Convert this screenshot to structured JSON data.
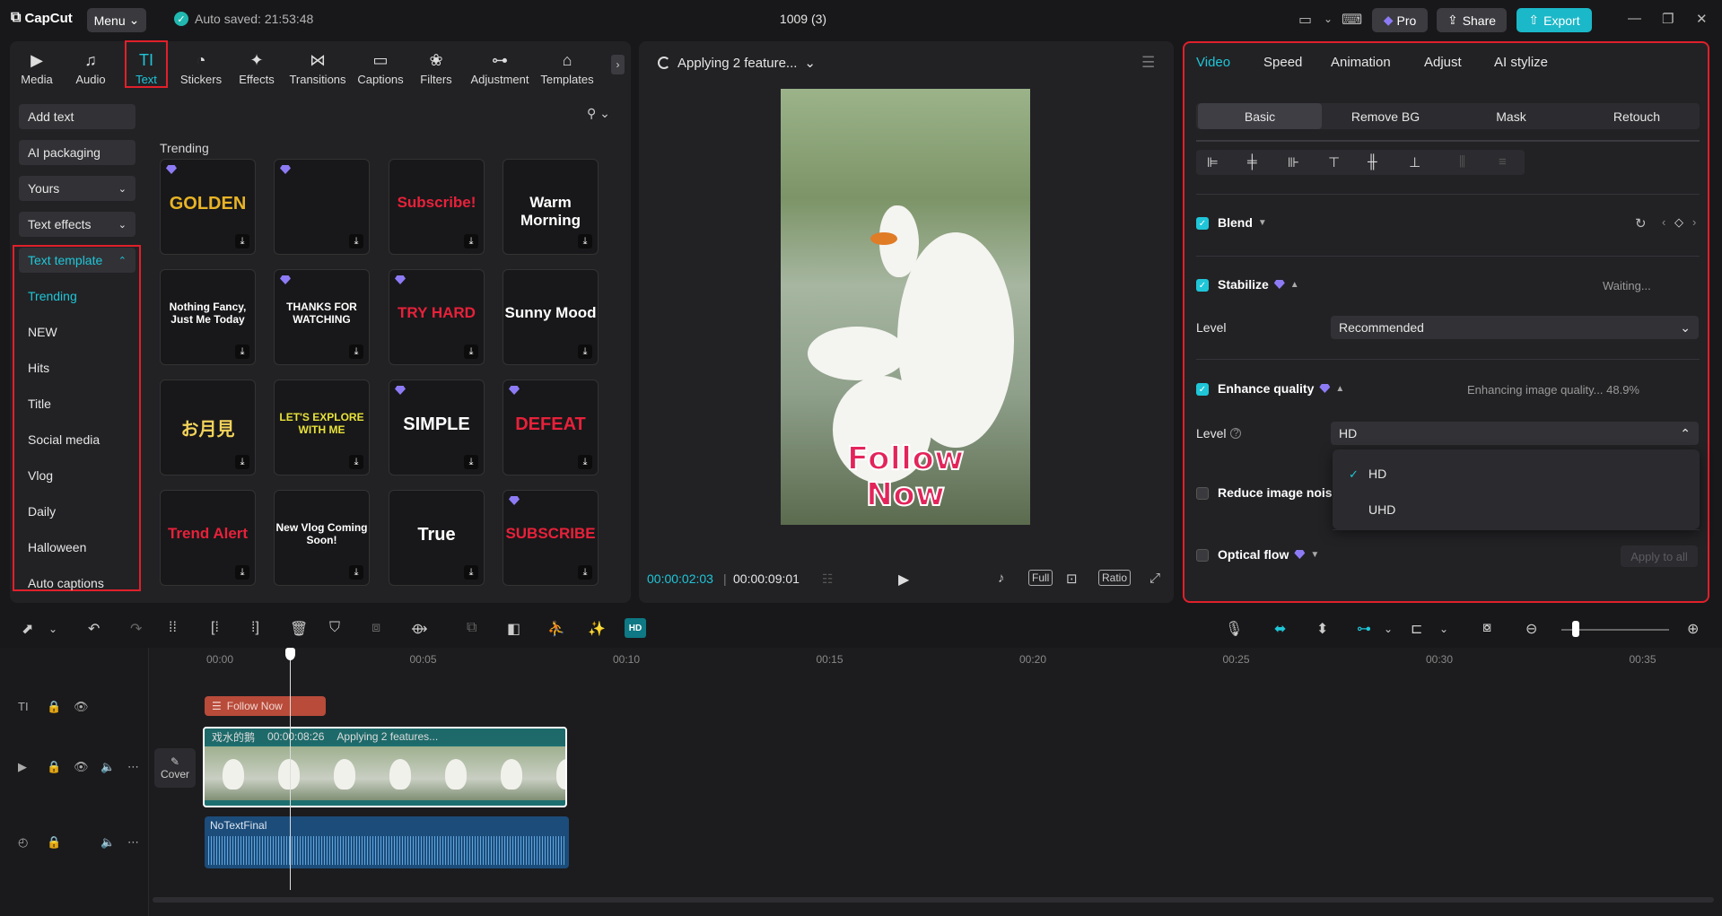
{
  "app": {
    "logo": "CapCut",
    "menu_label": "Menu",
    "autosave": "Auto saved: 21:53:48",
    "project_title": "1009 (3)",
    "pro_label": "Pro",
    "share_label": "Share",
    "export_label": "Export"
  },
  "left": {
    "tabs": [
      {
        "label": "Media",
        "icon": "▶"
      },
      {
        "label": "Audio",
        "icon": "♫"
      },
      {
        "label": "Text",
        "icon": "TI"
      },
      {
        "label": "Stickers",
        "icon": "◔"
      },
      {
        "label": "Effects",
        "icon": "✦"
      },
      {
        "label": "Transitions",
        "icon": "⋈"
      },
      {
        "label": "Captions",
        "icon": "▭"
      },
      {
        "label": "Filters",
        "icon": "❀"
      },
      {
        "label": "Adjustment",
        "icon": "⊶"
      },
      {
        "label": "Templates",
        "icon": "⌂"
      }
    ],
    "side_buttons": [
      "Add text",
      "AI packaging",
      "Yours",
      "Text effects",
      "Text template"
    ],
    "categories": [
      "Trending",
      "NEW",
      "Hits",
      "Title",
      "Social media",
      "Vlog",
      "Daily",
      "Halloween",
      "Auto captions"
    ],
    "section_title": "Trending",
    "cards": [
      {
        "text": "GOLDEN",
        "color": "#e8b326",
        "pro": true
      },
      {
        "text": "",
        "color": "#fff",
        "pro": true
      },
      {
        "text": "Subscribe!",
        "color": "#e8213a",
        "pro": false
      },
      {
        "text": "Warm Morning",
        "color": "#ffffff",
        "pro": false
      },
      {
        "text": "Nothing Fancy, Just Me Today",
        "color": "#ffffff",
        "pro": false
      },
      {
        "text": "THANKS FOR WATCHING",
        "color": "#ffffff",
        "pro": true
      },
      {
        "text": "TRY HARD",
        "color": "#e8213a",
        "pro": true
      },
      {
        "text": "Sunny Mood",
        "color": "#ffffff",
        "pro": false
      },
      {
        "text": "お月見",
        "color": "#f2d35a",
        "pro": false
      },
      {
        "text": "LET'S EXPLORE WITH ME",
        "color": "#e8e23a",
        "pro": false
      },
      {
        "text": "SIMPLE",
        "color": "#ffffff",
        "pro": true
      },
      {
        "text": "DEFEAT",
        "color": "#e8213a",
        "pro": true
      },
      {
        "text": "Trend Alert",
        "color": "#e8213a",
        "pro": false
      },
      {
        "text": "New Vlog Coming Soon!",
        "color": "#ffffff",
        "pro": false
      },
      {
        "text": "True",
        "color": "#ffffff",
        "pro": false
      },
      {
        "text": "SUBSCRIBE",
        "color": "#e8213a",
        "pro": true
      }
    ]
  },
  "preview": {
    "status": "Applying 2 feature...",
    "current_time": "00:00:02:03",
    "total_time": "00:00:09:01",
    "overlay_line1": "Follow",
    "overlay_line2": "Now",
    "controls": [
      "Full",
      "Ratio"
    ]
  },
  "right": {
    "tabs": [
      "Video",
      "Speed",
      "Animation",
      "Adjust",
      "AI stylize"
    ],
    "sub_tabs": [
      "Basic",
      "Remove BG",
      "Mask",
      "Retouch"
    ],
    "blend_label": "Blend",
    "stabilize_label": "Stabilize",
    "stabilize_status": "Waiting...",
    "level_label": "Level",
    "stabilize_level": "Recommended",
    "enhance_label": "Enhance quality",
    "enhance_status": "Enhancing image quality... 48.9%",
    "enhance_level": "HD",
    "dropdown_options": [
      "HD",
      "UHD"
    ],
    "reduce_noise_label": "Reduce image noise",
    "optical_flow_label": "Optical flow",
    "apply_all_label": "Apply to all"
  },
  "timeline": {
    "ruler": [
      "00:00",
      "00:05",
      "00:10",
      "00:15",
      "00:20",
      "00:25",
      "00:30",
      "00:35"
    ],
    "text_clip": "Follow  Now",
    "video_clip_name": "戏水的鹅",
    "video_clip_duration": "00:00:08:26",
    "video_clip_status": "Applying 2 features...",
    "audio_clip": "NoTextFinal",
    "cover_label": "Cover"
  }
}
